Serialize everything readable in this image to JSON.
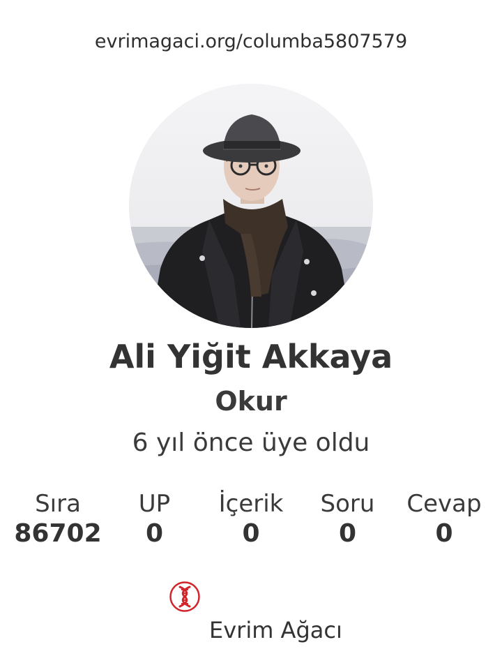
{
  "profile": {
    "url": "evrimagaci.org/columba5807579",
    "name": "Ali Yiğit Akkaya",
    "role": "Okur",
    "joined": "6 yıl önce üye oldu",
    "avatar": "profile-photo"
  },
  "stats": [
    {
      "label": "Sıra",
      "value": "86702"
    },
    {
      "label": "UP",
      "value": "0"
    },
    {
      "label": "İçerik",
      "value": "0"
    },
    {
      "label": "Soru",
      "value": "0"
    },
    {
      "label": "Cevap",
      "value": "0"
    }
  ],
  "brand": {
    "name": "Evrim Ağacı",
    "logo_icon": "dna-logo-icon",
    "accent_color": "#d0252b"
  }
}
